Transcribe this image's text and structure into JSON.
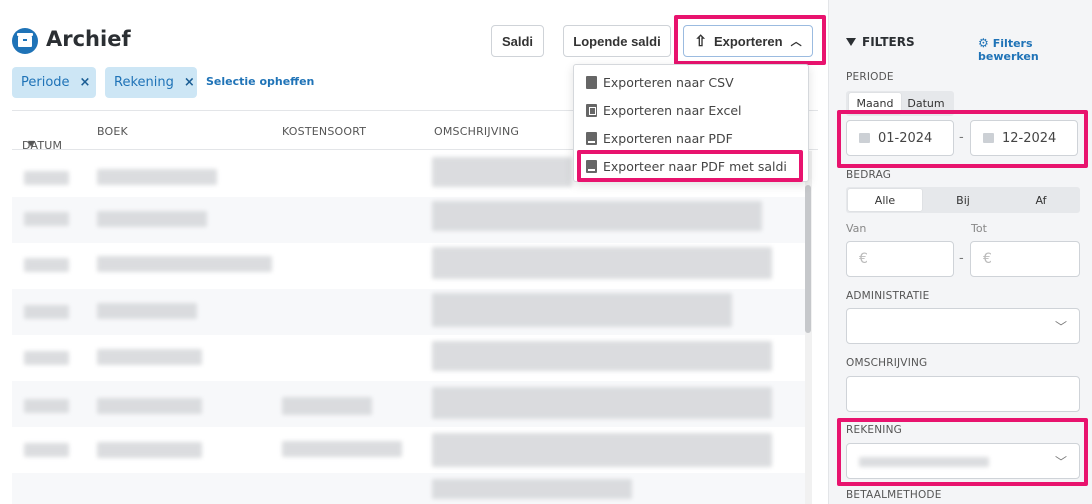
{
  "header": {
    "title": "Archief",
    "saldi_label": "Saldi",
    "lopende_saldi_label": "Lopende saldi",
    "export_label": "Exporteren"
  },
  "chips": {
    "periode": "Periode",
    "rekening": "Rekening",
    "remove_glyph": "×",
    "clear_label": "Selectie opheffen"
  },
  "table": {
    "columns": [
      "DATUM",
      "BOEK",
      "KOSTENSOORT",
      "OMSCHRIJVING"
    ],
    "sort_glyph": "▼"
  },
  "export_menu": {
    "items": [
      "Exporteren naar CSV",
      "Exporteren naar Excel",
      "Exporteren naar PDF",
      "Exporteer naar PDF met saldi"
    ]
  },
  "filters": {
    "title": "FILTERS",
    "edit_label": "Filters bewerken",
    "periode": {
      "label": "PERIODE",
      "tabs": [
        "Maand",
        "Datum"
      ],
      "from": "01-2024",
      "to": "12-2024",
      "separator": "-"
    },
    "bedrag": {
      "label": "BEDRAG",
      "options": [
        "Alle",
        "Bij",
        "Af"
      ],
      "van_label": "Van",
      "tot_label": "Tot",
      "currency": "€"
    },
    "administratie_label": "ADMINISTRATIE",
    "omschrijving_label": "OMSCHRIJVING",
    "rekening_label": "REKENING",
    "betaalmethode_label": "BETAALMETHODE"
  },
  "colors": {
    "accent": "#1f73b7",
    "highlight": "#e8136e",
    "chip_bg": "#cde6f5",
    "panel_bg": "#f4f5f7"
  },
  "icons": [
    "archive-icon",
    "upload-icon",
    "chevron-up-icon",
    "remove-icon",
    "sort-down-icon",
    "document-icon",
    "excel-icon",
    "pdf-icon",
    "funnel-icon",
    "gear-icon",
    "calendar-icon",
    "chevron-down-icon"
  ]
}
